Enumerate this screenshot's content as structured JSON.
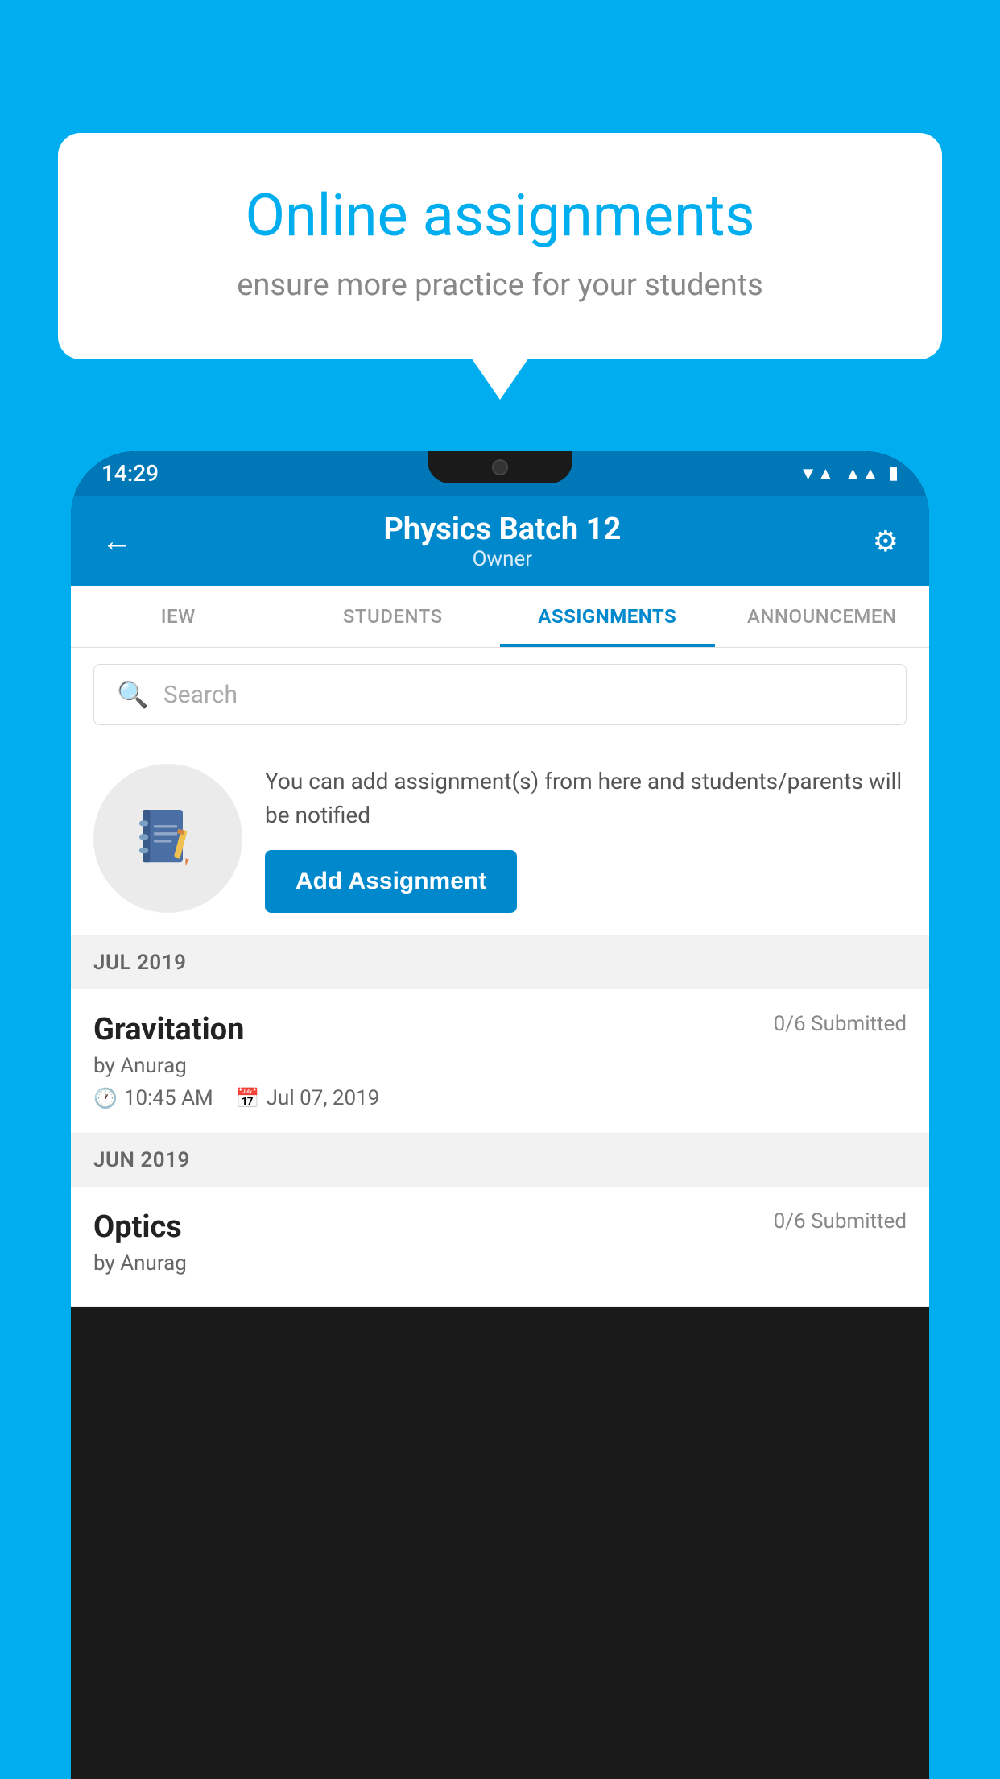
{
  "background": {
    "color": "#00AEEF"
  },
  "promo_card": {
    "title": "Online assignments",
    "subtitle": "ensure more practice for your students"
  },
  "status_bar": {
    "time": "14:29",
    "wifi_icon": "▼▲",
    "signal_icon": "▲▲",
    "battery_icon": "▮"
  },
  "app_header": {
    "back_icon": "←",
    "title": "Physics Batch 12",
    "subtitle": "Owner",
    "settings_icon": "⚙"
  },
  "tabs": [
    {
      "label": "IEW",
      "active": false
    },
    {
      "label": "STUDENTS",
      "active": false
    },
    {
      "label": "ASSIGNMENTS",
      "active": true
    },
    {
      "label": "ANNOUNCEMEN",
      "active": false
    }
  ],
  "search": {
    "placeholder": "Search"
  },
  "assignment_promo": {
    "description": "You can add assignment(s) from here and students/parents will be notified",
    "button_label": "Add Assignment"
  },
  "sections": [
    {
      "label": "JUL 2019",
      "assignments": [
        {
          "name": "Gravitation",
          "submitted": "0/6 Submitted",
          "author": "by Anurag",
          "time": "10:45 AM",
          "date": "Jul 07, 2019"
        }
      ]
    },
    {
      "label": "JUN 2019",
      "assignments": [
        {
          "name": "Optics",
          "submitted": "0/6 Submitted",
          "author": "by Anurag",
          "time": "",
          "date": ""
        }
      ]
    }
  ]
}
